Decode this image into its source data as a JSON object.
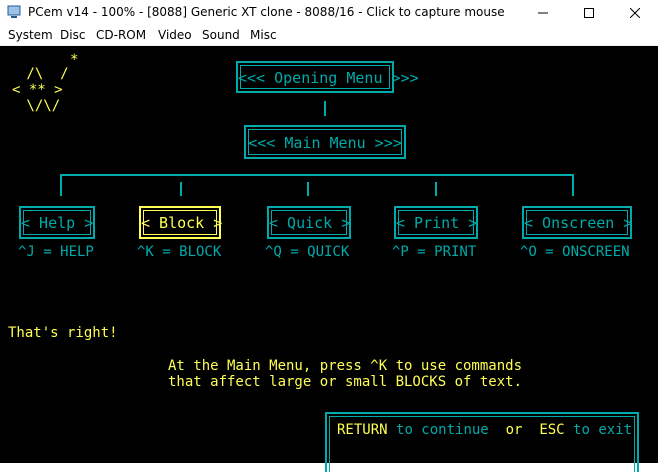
{
  "window": {
    "title": "PCem v14 - 100% - [8088] Generic XT clone - 8088/16 - Click to capture mouse",
    "controls": [
      "minimize",
      "maximize",
      "close"
    ]
  },
  "menubar": {
    "items": [
      "System",
      "Disc",
      "CD-ROM",
      "Video",
      "Sound",
      "Misc"
    ]
  },
  "screen": {
    "logo": {
      "line1": " /\\  /",
      "line2": "< ** >",
      "line3": " \\/\\/",
      "star": "*"
    },
    "opening_menu": "<<< Opening Menu >>>",
    "main_menu": "<<< Main Menu >>>",
    "boxes": [
      {
        "label": "< Help >",
        "key": "^J = HELP",
        "selected": false
      },
      {
        "label": "< Block >",
        "key": "^K = BLOCK",
        "selected": true
      },
      {
        "label": "< Quick >",
        "key": "^Q = QUICK",
        "selected": false
      },
      {
        "label": "< Print >",
        "key": "^P = PRINT",
        "selected": false
      },
      {
        "label": "< Onscreen >",
        "key": "^O = ONSCREEN",
        "selected": false
      }
    ],
    "feedback": "That's right!",
    "instruction_line1": "At the Main Menu, press ^K to use commands",
    "instruction_line2": "that affect large or small BLOCKS of text.",
    "footer": {
      "return_key": "RETURN",
      "to_continue": "to continue",
      "or": "or",
      "esc_key": "ESC",
      "to_exit": "to exit"
    },
    "colors": {
      "background": "#000000",
      "cyan": "#00aaaa",
      "yellow": "#ffff55"
    }
  }
}
